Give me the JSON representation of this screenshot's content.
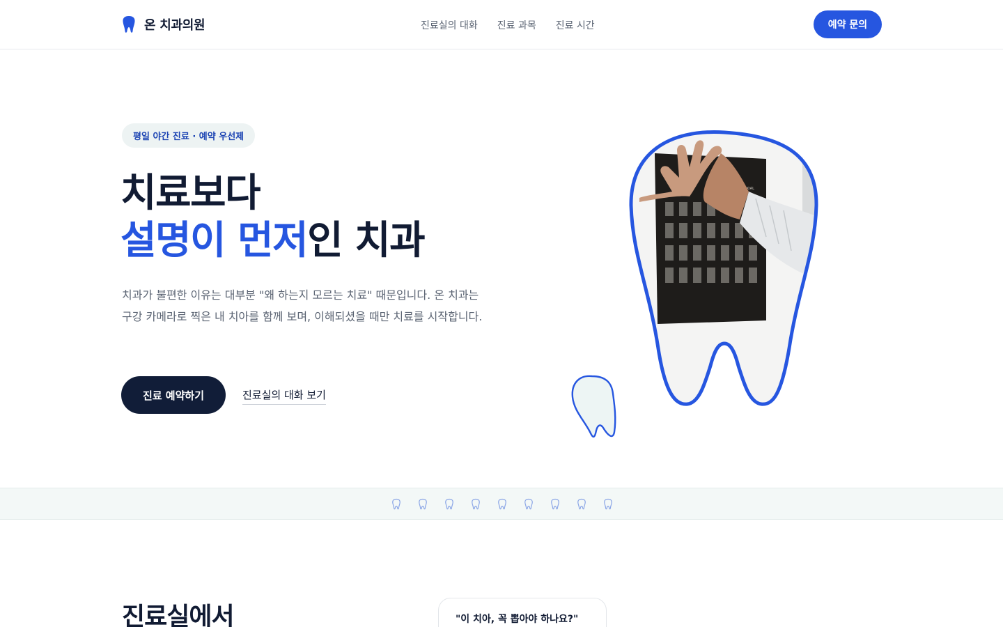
{
  "header": {
    "brand_icon": "tooth-icon",
    "brand_name": "온 치과의원",
    "nav": [
      "진료실의 대화",
      "진료 과목",
      "진료 시간"
    ],
    "cta": "예약 문의"
  },
  "hero": {
    "badge": "평일 야간 진료 · 예약 우선제",
    "title_line1": "치료보다",
    "title_accent": "설명이 먼저",
    "title_rest": "인 치과",
    "description": "치과가 불편한 이유는 대부분 \"왜 하는지 모르는 치료\" 때문입니다. 온 치과는 구강 카메라로 찍은 내 치아를 함께 보며, 이해되셨을 때만 치료를 시작합니다.",
    "primary_button": "진료 예약하기",
    "secondary_link": "진료실의 대화 보기",
    "image_content": "hand-pointing-at-dental-xray-photo",
    "x_ray_labels": [
      "CORTE AXIAL"
    ]
  },
  "strip": {
    "icon": "tooth-outline-icon",
    "count": 9
  },
  "section": {
    "title": "진료실에서",
    "quote": "\"이 치아, 꼭 뽑아야 하나요?\""
  },
  "colors": {
    "accent": "#2656e0",
    "navy": "#111d38",
    "text_muted": "#5b6473",
    "mint_bg": "#edf3f3"
  }
}
